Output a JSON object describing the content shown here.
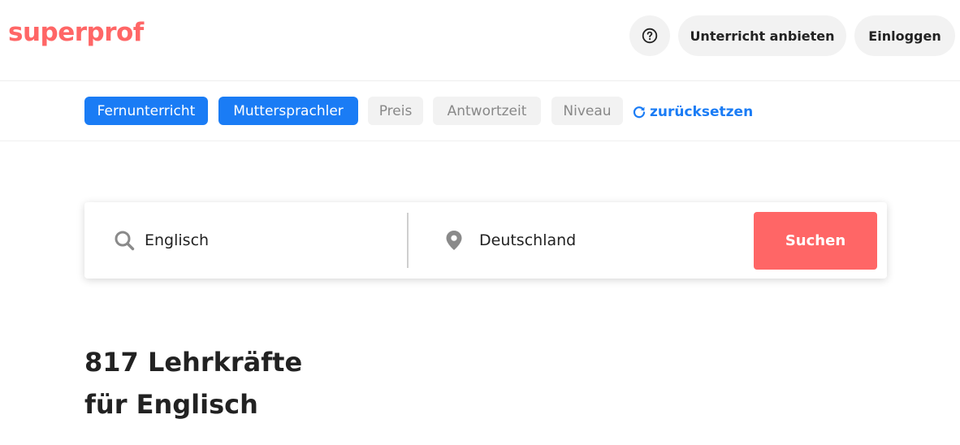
{
  "header": {
    "logo": "superprof",
    "help_icon": "question-circle-icon",
    "teach_label": "Unterricht anbieten",
    "login_label": "Einloggen"
  },
  "filters": {
    "chips": [
      {
        "label": "Fernunterricht",
        "active": true
      },
      {
        "label": "Muttersprachler",
        "active": true
      },
      {
        "label": "Preis",
        "active": false
      },
      {
        "label": "Antwortzeit",
        "active": false
      },
      {
        "label": "Niveau",
        "active": false
      }
    ],
    "reset_icon": "refresh-icon",
    "reset_label": "zurücksetzen"
  },
  "search": {
    "subject_icon": "search-icon",
    "subject_value": "Englisch",
    "location_icon": "location-pin-icon",
    "location_value": "Deutschland",
    "submit_label": "Suchen"
  },
  "results": {
    "line1": "817 Lehrkräfte",
    "line2": "für Englisch"
  },
  "colors": {
    "brand": "#ff6666",
    "accent_blue": "#1a7cf5",
    "chip_inactive_bg": "#f2f2f2",
    "chip_inactive_text": "#888888"
  }
}
